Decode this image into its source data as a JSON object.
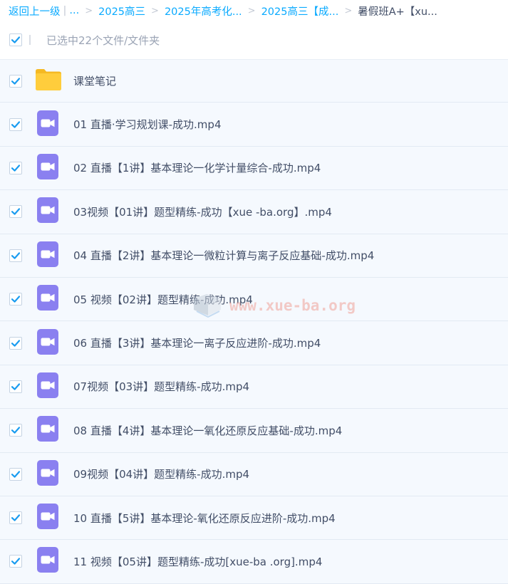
{
  "breadcrumb": {
    "back_label": "返回上一级",
    "pipe": "|",
    "ellipsis": "...",
    "separator": ">",
    "items": [
      {
        "label": "2025高三"
      },
      {
        "label": "2025年高考化..."
      },
      {
        "label": "2025高三【成..."
      }
    ],
    "current": "暑假班A+【xu..."
  },
  "selection": {
    "text": "已选中22个文件/文件夹"
  },
  "files": [
    {
      "name": "课堂笔记",
      "type": "folder",
      "checked": true
    },
    {
      "name": "01 直播·学习规划课-成功.mp4",
      "type": "video",
      "checked": true
    },
    {
      "name": "02 直播【1讲】基本理论一化学计量综合-成功.mp4",
      "type": "video",
      "checked": true
    },
    {
      "name": "03视频【01讲】题型精练-成功【xue -ba.org】.mp4",
      "type": "video",
      "checked": true
    },
    {
      "name": "04 直播【2讲】基本理论一微粒计算与离子反应基础-成功.mp4",
      "type": "video",
      "checked": true
    },
    {
      "name": "05 视频【02讲】题型精练-成功.mp4",
      "type": "video",
      "checked": true
    },
    {
      "name": "06 直播【3讲】基本理论一离子反应进阶-成功.mp4",
      "type": "video",
      "checked": true
    },
    {
      "name": "07视频【03讲】题型精练-成功.mp4",
      "type": "video",
      "checked": true
    },
    {
      "name": "08 直播【4讲】基本理论一氧化还原反应基础-成功.mp4",
      "type": "video",
      "checked": true
    },
    {
      "name": "09视频【04讲】题型精练-成功.mp4",
      "type": "video",
      "checked": true
    },
    {
      "name": "10 直播【5讲】基本理论-氧化还原反应进阶-成功.mp4",
      "type": "video",
      "checked": true
    },
    {
      "name": "11 视频【05讲】题型精练-成功[xue-ba .org].mp4",
      "type": "video",
      "checked": true
    }
  ],
  "watermark": {
    "text": "www.xue-ba.org"
  },
  "colors": {
    "link": "#09aaff",
    "check": "#1a9cf0",
    "video_icon": "#8a80f0",
    "folder_icon": "#ffcd3c",
    "row_bg": "#f5f9fe"
  }
}
